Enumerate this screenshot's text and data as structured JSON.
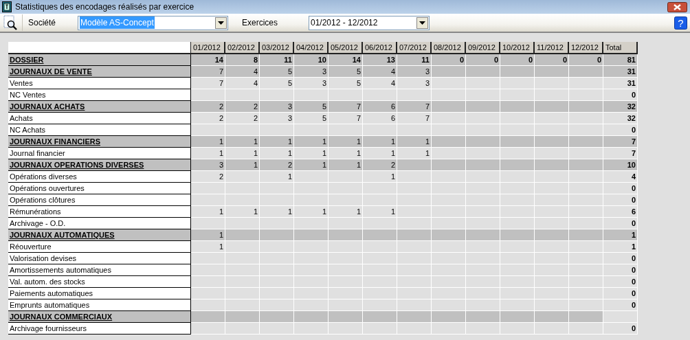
{
  "window": {
    "title": "Statistiques des encodages réalisés par exercice"
  },
  "toolbar": {
    "societe_label": "Société",
    "societe": {
      "value": "Modèle AS-Concept",
      "selected": true
    },
    "exercices_label": "Exercices",
    "exercices": {
      "value": "01/2012 - 12/2012",
      "selected": false
    },
    "help": "?"
  },
  "table": {
    "columns": [
      "01/2012",
      "02/2012",
      "03/2012",
      "04/2012",
      "05/2012",
      "06/2012",
      "07/2012",
      "08/2012",
      "09/2012",
      "10/2012",
      "11/2012",
      "12/2012",
      "Total"
    ],
    "rows": [
      {
        "kind": "summary",
        "label": "DOSSIER",
        "values": {
          "month_01": "14",
          "month_02": "8",
          "month_03": "11",
          "month_04": "10",
          "month_05": "14",
          "month_06": "13",
          "month_07": "11",
          "month_08": "0",
          "month_09": "0",
          "month_10": "0",
          "month_11": "0",
          "month_12": "0"
        },
        "total": "81"
      },
      {
        "kind": "group",
        "label": "JOURNAUX DE VENTE",
        "values": {
          "month_01": "7",
          "month_02": "4",
          "month_03": "5",
          "month_04": "3",
          "month_05": "5",
          "month_06": "4",
          "month_07": "3"
        },
        "total": "31"
      },
      {
        "kind": "item",
        "label": "Ventes",
        "values": {
          "month_01": "7",
          "month_02": "4",
          "month_03": "5",
          "month_04": "3",
          "month_05": "5",
          "month_06": "4",
          "month_07": "3"
        },
        "total": "31"
      },
      {
        "kind": "item",
        "label": "NC Ventes",
        "total": "0"
      },
      {
        "kind": "group",
        "label": "JOURNAUX ACHATS",
        "values": {
          "month_01": "2",
          "month_02": "2",
          "month_03": "3",
          "month_04": "5",
          "month_05": "7",
          "month_06": "6",
          "month_07": "7"
        },
        "total": "32"
      },
      {
        "kind": "item",
        "label": "Achats",
        "values": {
          "month_01": "2",
          "month_02": "2",
          "month_03": "3",
          "month_04": "5",
          "month_05": "7",
          "month_06": "6",
          "month_07": "7"
        },
        "total": "32"
      },
      {
        "kind": "item",
        "label": "NC Achats",
        "total": "0"
      },
      {
        "kind": "group",
        "label": "JOURNAUX FINANCIERS",
        "values": {
          "month_01": "1",
          "month_02": "1",
          "month_03": "1",
          "month_04": "1",
          "month_05": "1",
          "month_06": "1",
          "month_07": "1"
        },
        "total": "7"
      },
      {
        "kind": "item",
        "label": "Journal financier",
        "values": {
          "month_01": "1",
          "month_02": "1",
          "month_03": "1",
          "month_04": "1",
          "month_05": "1",
          "month_06": "1",
          "month_07": "1"
        },
        "total": "7"
      },
      {
        "kind": "group",
        "label": "JOURNAUX OPERATIONS DIVERSES",
        "values": {
          "month_01": "3",
          "month_02": "1",
          "month_03": "2",
          "month_04": "1",
          "month_05": "1",
          "month_06": "2"
        },
        "total": "10"
      },
      {
        "kind": "item",
        "label": "Opérations diverses",
        "values": {
          "month_01": "2",
          "month_03": "1",
          "month_06": "1"
        },
        "total": "4"
      },
      {
        "kind": "item",
        "label": "Opérations ouvertures",
        "total": "0"
      },
      {
        "kind": "item",
        "label": "Opérations clôtures",
        "total": "0"
      },
      {
        "kind": "item",
        "label": "Rémunérations",
        "values": {
          "month_01": "1",
          "month_02": "1",
          "month_03": "1",
          "month_04": "1",
          "month_05": "1",
          "month_06": "1"
        },
        "total": "6"
      },
      {
        "kind": "item",
        "label": "Archivage - O.D.",
        "total": "0"
      },
      {
        "kind": "group",
        "label": "JOURNAUX AUTOMATIQUES",
        "values": {
          "month_01": "1"
        },
        "total": "1"
      },
      {
        "kind": "item",
        "label": "Réouverture",
        "values": {
          "month_01": "1"
        },
        "total": "1"
      },
      {
        "kind": "item",
        "label": "Valorisation devises",
        "total": "0"
      },
      {
        "kind": "item",
        "label": "Amortissements automatiques",
        "total": "0"
      },
      {
        "kind": "item",
        "label": "Val. autom. des stocks",
        "total": "0"
      },
      {
        "kind": "item",
        "label": "Paiements automatiques",
        "total": "0"
      },
      {
        "kind": "item",
        "label": "Emprunts automatiques",
        "total": "0"
      },
      {
        "kind": "group",
        "label": "JOURNAUX COMMERCIAUX"
      },
      {
        "kind": "item",
        "label": "Archivage fournisseurs",
        "total": "0"
      }
    ]
  }
}
